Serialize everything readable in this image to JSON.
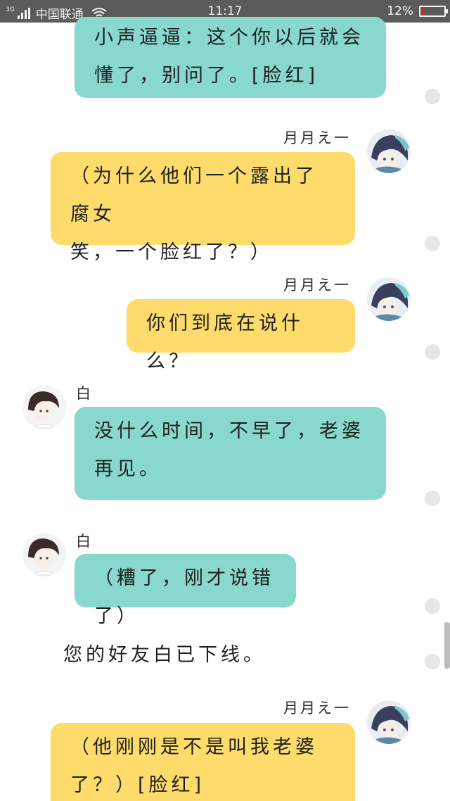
{
  "status_bar": {
    "network": "3G",
    "carrier": "中国联通",
    "time": "11:17",
    "battery_text": "12%",
    "battery_level": 0.12,
    "wifi_icon": "wifi-icon",
    "signal_icon": "signal-icon"
  },
  "messages": [
    {
      "side": "left",
      "sender": "",
      "text_lines": [
        "小声逼逼：这个你以后就会",
        "懂了，别问了。[脸红]"
      ],
      "color": "#88d8cf"
    },
    {
      "side": "right",
      "sender": "月月え一",
      "text_lines": [
        "（为什么他们一个露出了腐女",
        "笑，一个脸红了？）"
      ],
      "color": "#fddc6c"
    },
    {
      "side": "right",
      "sender": "月月え一",
      "text_lines": [
        "你们到底在说什么？"
      ],
      "color": "#fddc6c"
    },
    {
      "side": "left",
      "sender": "白",
      "text_lines": [
        "没什么时间，不早了，老婆",
        "再见。"
      ],
      "color": "#88d8cf"
    },
    {
      "side": "left",
      "sender": "白",
      "text_lines": [
        "（糟了，刚才说错了）"
      ],
      "color": "#88d8cf"
    },
    {
      "side": "right",
      "sender": "月月え一",
      "text_lines": [
        "（他刚刚是不是叫我老婆",
        "了？）[脸红]"
      ],
      "color": "#fddc6c"
    }
  ],
  "system_message": "您的好友白已下线。",
  "colors": {
    "teal_bubble": "#88d8cf",
    "yellow_bubble": "#fddc6c",
    "status_bar": "#5b5b5b",
    "battery_low": "#e02424"
  }
}
